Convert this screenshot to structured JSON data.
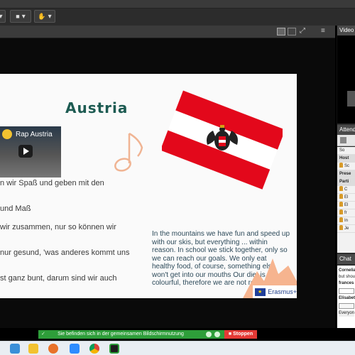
{
  "window": {
    "share_title": "Video",
    "attendees_title": "Attend",
    "chat_title": "Chat"
  },
  "slide": {
    "title": "Austria",
    "video": {
      "title": "Rap Austria"
    },
    "german_lines": [
      "n wir Spaß und geben mit den",
      "und Maß",
      "wir zusammen, nur so können wir",
      "nur gesund, 'was anderes kommt uns",
      "st ganz bunt, darum sind wir auch"
    ],
    "english_text": "In the mountains we have fun and speed up with our skis, but everything ... within reason. In school we stick together, only so we can reach our goals. We only eat healthy food, of course, something else won't get into our mouths Our diet is very colourful, therefore we are not roly-poly.",
    "erasmus_label": "Erasmus+"
  },
  "attendees": {
    "sections": [
      "Host",
      "Prese",
      "Parti"
    ],
    "hosts": [
      "Sc"
    ],
    "participants": [
      "C",
      "El",
      "El",
      "fr",
      "In",
      "Je"
    ]
  },
  "chat": {
    "messages": [
      "Cornelia",
      "but shou",
      "frances",
      "Elisabet"
    ],
    "footer": "Everyon"
  },
  "status": {
    "sharing_text": "Sie befinden sich in der gemeinsamen Bildschirmnutzung",
    "stop_label": "Stoppen"
  },
  "colors": {
    "accent_green": "#2e9e3a",
    "stop_red": "#e53935",
    "flag_red": "#e3081b",
    "title_teal": "#1d5b52"
  },
  "icons": {
    "share_stop": "stop-square-icon",
    "mic": "microphone-icon",
    "layout": "layout-grid-icon"
  }
}
